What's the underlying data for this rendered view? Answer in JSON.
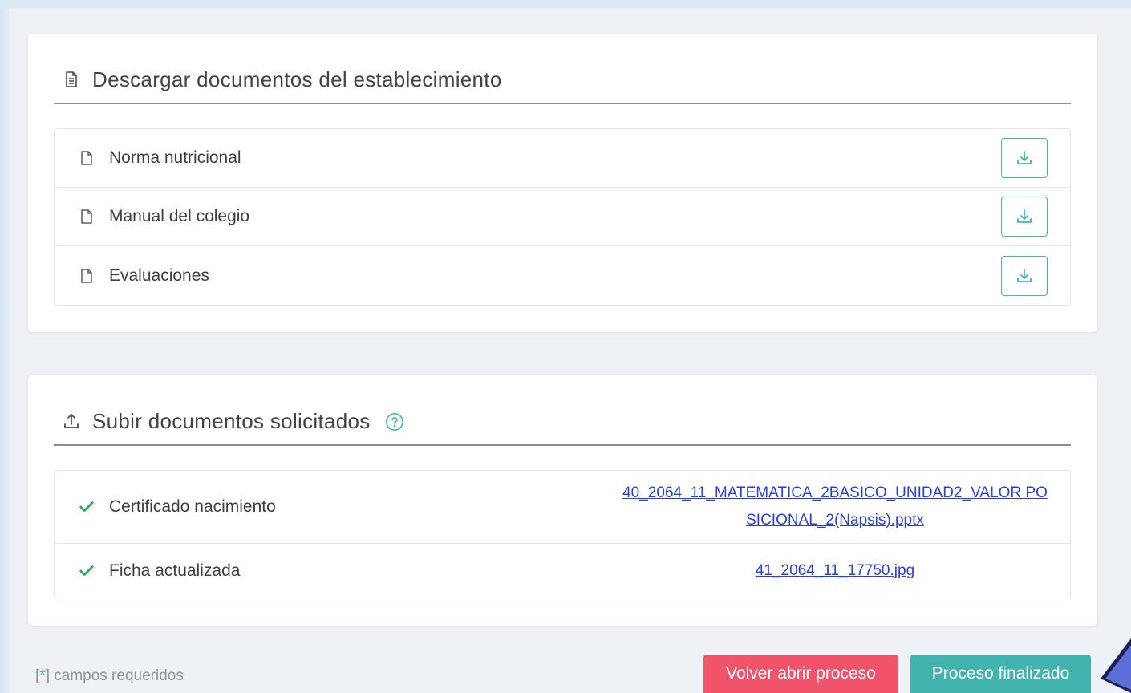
{
  "download_section": {
    "title": "Descargar documentos del establecimiento",
    "items": [
      {
        "label": "Norma nutricional"
      },
      {
        "label": "Manual del colegio"
      },
      {
        "label": "Evaluaciones"
      }
    ]
  },
  "upload_section": {
    "title": "Subir documentos solicitados",
    "items": [
      {
        "label": "Certificado nacimiento",
        "file": "40_2064_11_MATEMATICA_2BASICO_UNIDAD2_VALOR POSICIONAL_2(Napsis).pptx"
      },
      {
        "label": "Ficha actualizada",
        "file": "41_2064_11_17750.jpg"
      }
    ]
  },
  "footer": {
    "required_note_bracket_open": "[",
    "required_note_star": "*",
    "required_note_bracket_close": "]",
    "required_note_text": " campos requeridos",
    "reopen_button": "Volver abrir proceso",
    "finished_button": "Proceso finalizado"
  },
  "colors": {
    "accent_teal": "#43b3ad",
    "danger_red": "#f0546a",
    "link_blue": "#2a3fd9",
    "check_green": "#1fae5b"
  }
}
